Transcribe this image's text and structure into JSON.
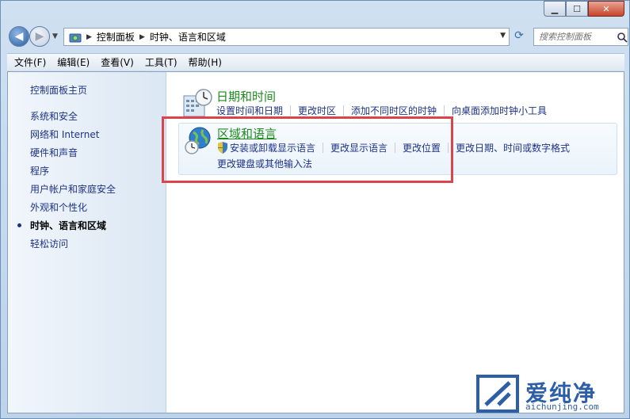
{
  "window": {
    "minimize": "▁",
    "maximize": "☐",
    "close": "✕"
  },
  "address_bar": {
    "crumbs": [
      "控制面板",
      "时钟、语言和区域"
    ]
  },
  "search": {
    "placeholder": "搜索控制面板"
  },
  "menu": {
    "items": [
      "文件(F)",
      "编辑(E)",
      "查看(V)",
      "工具(T)",
      "帮助(H)"
    ]
  },
  "sidebar": {
    "home": "控制面板主页",
    "items": [
      {
        "label": "系统和安全"
      },
      {
        "label": "网络和 Internet"
      },
      {
        "label": "硬件和声音"
      },
      {
        "label": "程序"
      },
      {
        "label": "用户帐户和家庭安全"
      },
      {
        "label": "外观和个性化"
      },
      {
        "label": "时钟、语言和区域",
        "current": true
      },
      {
        "label": "轻松访问"
      }
    ]
  },
  "categories": {
    "datetime": {
      "title": "日期和时间",
      "links": [
        "设置时间和日期",
        "更改时区",
        "添加不同时区的时钟",
        "向桌面添加时钟小工具"
      ]
    },
    "region": {
      "title": "区域和语言",
      "links_row1": [
        "安装或卸载显示语言",
        "更改显示语言",
        "更改位置",
        "更改日期、时间或数字格式"
      ],
      "links_row2": [
        "更改键盘或其他输入法"
      ]
    }
  },
  "watermark": {
    "title": "爱纯净",
    "url": "aichunjing.com"
  },
  "colors": {
    "link": "#1e3287",
    "category_title": "#1d8a1d",
    "highlight_box": "#d8464b"
  }
}
